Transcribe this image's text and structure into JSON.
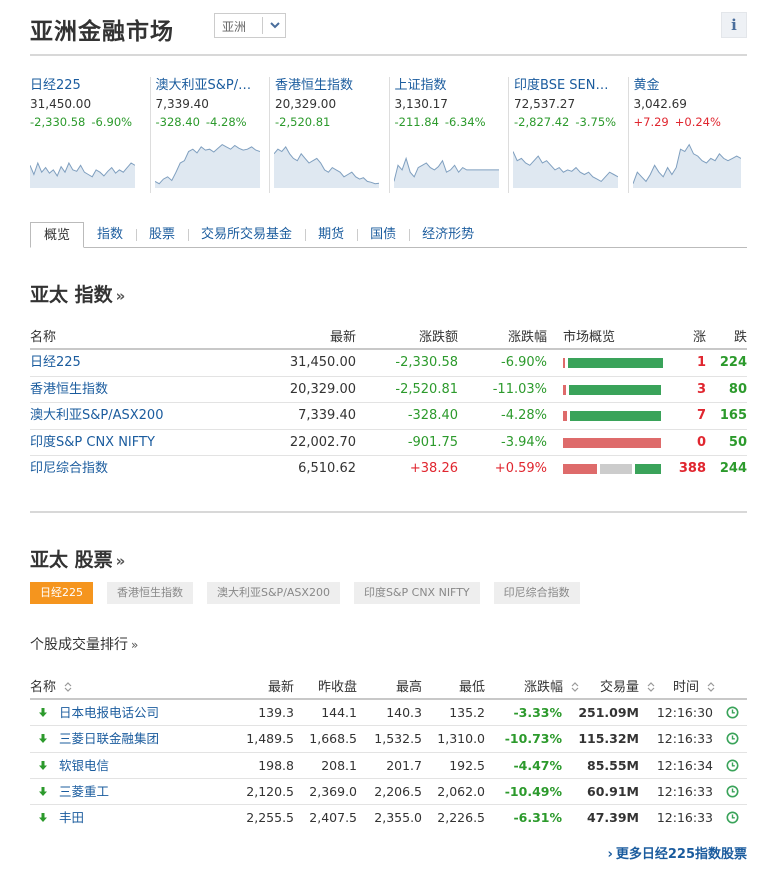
{
  "header": {
    "title": "亚洲金融市场",
    "region_value": "亚洲",
    "info_label": "i"
  },
  "indices_strip": [
    {
      "name": "日经225",
      "price": "31,450.00",
      "change": "-2,330.58",
      "pct": "-6.90%",
      "dir": "neg",
      "spark": [
        0.45,
        0.25,
        0.5,
        0.3,
        0.4,
        0.28,
        0.35,
        0.22,
        0.42,
        0.3,
        0.5,
        0.35,
        0.32,
        0.45,
        0.3,
        0.25,
        0.2,
        0.35,
        0.3,
        0.22,
        0.32,
        0.4,
        0.28,
        0.35,
        0.3,
        0.4,
        0.5,
        0.45
      ]
    },
    {
      "name": "澳大利亚S&P/…",
      "price": "7,339.40",
      "change": "-328.40",
      "pct": "-4.28%",
      "dir": "neg",
      "spark": [
        0.1,
        0.05,
        0.15,
        0.2,
        0.12,
        0.3,
        0.5,
        0.55,
        0.75,
        0.8,
        0.72,
        0.85,
        0.78,
        0.8,
        0.74,
        0.82,
        0.9,
        0.85,
        0.8,
        0.88,
        0.82,
        0.78,
        0.8,
        0.85,
        0.78,
        0.75
      ]
    },
    {
      "name": "香港恒生指数",
      "price": "20,329.00",
      "change": "-2,520.81",
      "pct": "",
      "dir": "neg",
      "spark": [
        0.7,
        0.8,
        0.75,
        0.85,
        0.7,
        0.6,
        0.55,
        0.7,
        0.6,
        0.5,
        0.55,
        0.6,
        0.5,
        0.35,
        0.3,
        0.4,
        0.35,
        0.3,
        0.2,
        0.25,
        0.3,
        0.2,
        0.15,
        0.18,
        0.1,
        0.08,
        0.05,
        0.06
      ]
    },
    {
      "name": "上证指数",
      "price": "3,130.17",
      "change": "-211.84",
      "pct": "-6.34%",
      "dir": "neg",
      "spark": [
        0.1,
        0.45,
        0.35,
        0.6,
        0.3,
        0.2,
        0.4,
        0.45,
        0.5,
        0.4,
        0.35,
        0.42,
        0.55,
        0.3,
        0.35,
        0.45,
        0.3,
        0.4,
        0.35,
        0.35,
        0.35,
        0.35,
        0.35,
        0.35,
        0.35,
        0.35,
        0.35
      ]
    },
    {
      "name": "印度BSE SEN…",
      "price": "72,537.27",
      "change": "-2,827.42",
      "pct": "-3.75%",
      "dir": "neg",
      "spark": [
        0.75,
        0.55,
        0.6,
        0.5,
        0.45,
        0.55,
        0.65,
        0.5,
        0.55,
        0.45,
        0.35,
        0.4,
        0.3,
        0.35,
        0.32,
        0.4,
        0.3,
        0.25,
        0.3,
        0.2,
        0.15,
        0.1,
        0.2,
        0.3,
        0.25,
        0.2
      ]
    },
    {
      "name": "黄金",
      "price": "3,042.69",
      "change": "+7.29",
      "pct": "+0.24%",
      "dir": "pos",
      "spark": [
        0.05,
        0.3,
        0.2,
        0.1,
        0.25,
        0.45,
        0.3,
        0.2,
        0.4,
        0.25,
        0.4,
        0.8,
        0.75,
        0.9,
        0.7,
        0.65,
        0.55,
        0.5,
        0.6,
        0.55,
        0.7,
        0.6,
        0.55,
        0.6,
        0.65,
        0.6
      ]
    }
  ],
  "tabs": [
    "概览",
    "指数",
    "股票",
    "交易所交易基金",
    "期货",
    "国债",
    "经济形势"
  ],
  "index_section": {
    "title": "亚太 指数",
    "arrow": "»",
    "columns": [
      "名称",
      "最新",
      "涨跌额",
      "涨跌幅",
      "市场概览",
      "涨",
      "跌"
    ],
    "rows": [
      {
        "name": "日经225",
        "last": "31,450.00",
        "chg": "-2,330.58",
        "pct": "-6.90%",
        "dir": "neg",
        "up": "1",
        "down": "224",
        "breadth": {
          "up": 0.004,
          "flat": 0,
          "down": 0.996
        }
      },
      {
        "name": "香港恒生指数",
        "last": "20,329.00",
        "chg": "-2,520.81",
        "pct": "-11.03%",
        "dir": "neg",
        "up": "3",
        "down": "80",
        "breadth": {
          "up": 0.036,
          "flat": 0,
          "down": 0.964
        }
      },
      {
        "name": "澳大利亚S&P/ASX200",
        "last": "7,339.40",
        "chg": "-328.40",
        "pct": "-4.28%",
        "dir": "neg",
        "up": "7",
        "down": "165",
        "breadth": {
          "up": 0.04,
          "flat": 0,
          "down": 0.96
        }
      },
      {
        "name": "印度S&P CNX NIFTY",
        "last": "22,002.70",
        "chg": "-901.75",
        "pct": "-3.94%",
        "dir": "neg",
        "up": "0",
        "down": "50",
        "breadth": {
          "up": 1.0,
          "flat": 0,
          "down": 0
        }
      },
      {
        "name": "印尼综合指数",
        "last": "6,510.62",
        "chg": "+38.26",
        "pct": "+0.59%",
        "dir": "pos",
        "up": "388",
        "down": "244",
        "breadth": {
          "up": 0.37,
          "flat": 0.35,
          "down": 0.28
        }
      }
    ]
  },
  "stock_section": {
    "title": "亚太 股票",
    "arrow": "»",
    "pills": [
      "日经225",
      "香港恒生指数",
      "澳大利亚S&P/ASX200",
      "印度S&P CNX NIFTY",
      "印尼综合指数"
    ],
    "subtitle": "个股成交量排行",
    "subtitle_arrow": "»",
    "columns": [
      "名称",
      "最新",
      "昨收盘",
      "最高",
      "最低",
      "涨跌幅",
      "交易量",
      "时间"
    ],
    "rows": [
      {
        "name": "日本电报电话公司",
        "last": "139.3",
        "prev": "144.1",
        "high": "140.3",
        "low": "135.2",
        "pct": "-3.33%",
        "vol": "251.09M",
        "time": "12:16:30"
      },
      {
        "name": "三菱日联金融集团",
        "last": "1,489.5",
        "prev": "1,668.5",
        "high": "1,532.5",
        "low": "1,310.0",
        "pct": "-10.73%",
        "vol": "115.32M",
        "time": "12:16:33"
      },
      {
        "name": "软银电信",
        "last": "198.8",
        "prev": "208.1",
        "high": "201.7",
        "low": "192.5",
        "pct": "-4.47%",
        "vol": "85.55M",
        "time": "12:16:34"
      },
      {
        "name": "三菱重工",
        "last": "2,120.5",
        "prev": "2,369.0",
        "high": "2,206.5",
        "low": "2,062.0",
        "pct": "-10.49%",
        "vol": "60.91M",
        "time": "12:16:33"
      },
      {
        "name": "丰田",
        "last": "2,255.5",
        "prev": "2,407.5",
        "high": "2,355.0",
        "low": "2,226.5",
        "pct": "-6.31%",
        "vol": "47.39M",
        "time": "12:16:33"
      }
    ],
    "more_link": "更多日经225指数股票"
  },
  "colors": {
    "link": "#1b5c9e",
    "down_green": "#2c9a2c",
    "up_red": "#e0262f",
    "bar_green": "#3aa35a",
    "bar_red": "#de6b6b",
    "bar_grey": "#cccccc",
    "spark_fill": "#dfe8f1",
    "spark_line": "#7f9fbf",
    "pill_active": "#f5951e"
  }
}
